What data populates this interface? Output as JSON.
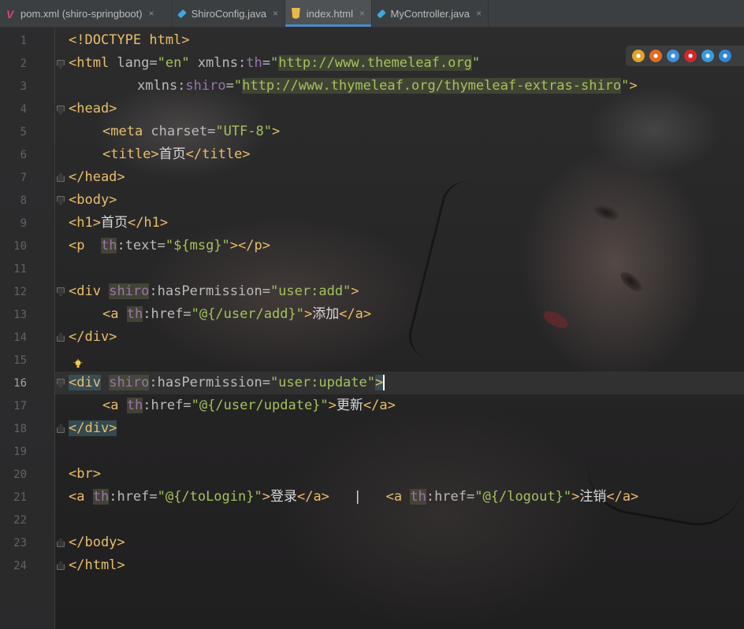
{
  "tabs": [
    {
      "label": "pom.xml (shiro-springboot)",
      "icon": "maven-v-icon",
      "active": false
    },
    {
      "label": "ShiroConfig.java",
      "icon": "java-class-icon",
      "active": false
    },
    {
      "label": "index.html",
      "icon": "html5-icon",
      "active": true
    },
    {
      "label": "MyController.java",
      "icon": "java-class-icon",
      "active": false
    }
  ],
  "close_glyph": "×",
  "line_numbers": [
    "1",
    "2",
    "3",
    "4",
    "5",
    "6",
    "7",
    "8",
    "9",
    "10",
    "11",
    "12",
    "13",
    "14",
    "15",
    "16",
    "17",
    "18",
    "19",
    "20",
    "21",
    "22",
    "23",
    "24"
  ],
  "current_line": "16",
  "code": {
    "l1": [
      "<!DOCTYPE html>"
    ],
    "l2": [
      "<html",
      " lang",
      "=",
      "\"en\"",
      " xmlns:",
      "th",
      "=",
      "\"",
      "http://www.themeleaf.org",
      "\""
    ],
    "l3": [
      "xmlns:",
      "shiro",
      "=",
      "\"",
      "http://www.thymeleaf.org/thymeleaf-extras-shiro",
      "\"",
      ">"
    ],
    "l4": [
      "<head>"
    ],
    "l5": [
      "<meta",
      " charset",
      "=",
      "\"UTF-8\"",
      ">"
    ],
    "l6": [
      "<title>",
      "首页",
      "</title>"
    ],
    "l7": [
      "</head>"
    ],
    "l8": [
      "<body>"
    ],
    "l9": [
      "<h1>",
      "首页",
      "</h1>"
    ],
    "l10": [
      "<p",
      "th",
      ":text",
      "=",
      "\"${msg}\"",
      "></p>"
    ],
    "l12": [
      "<div",
      "shiro",
      ":hasPermission",
      "=",
      "\"user:add\"",
      ">"
    ],
    "l13": [
      "<a",
      "th",
      ":href",
      "=",
      "\"@{/user/add}\"",
      ">",
      "添加",
      "</a>"
    ],
    "l14": [
      "</div>"
    ],
    "l16": [
      "<div",
      "shiro",
      ":hasPermission",
      "=",
      "\"user:update\"",
      ">"
    ],
    "l17": [
      "<a",
      "th",
      ":href",
      "=",
      "\"@{/user/update}\"",
      ">",
      "更新",
      "</a>"
    ],
    "l18": [
      "</div>"
    ],
    "l20": [
      "<br>"
    ],
    "l21": [
      "<a",
      "th",
      ":href",
      "=",
      "\"@{/toLogin}\"",
      ">",
      "登录",
      "</a>",
      "|",
      "<a",
      "th",
      ":href",
      "=",
      "\"@{/logout}\"",
      ">",
      "注销",
      "</a>"
    ],
    "l23": [
      "</body>"
    ],
    "l24": [
      "</html>"
    ]
  },
  "browsers": [
    {
      "name": "chrome-icon",
      "color": "#e0a32a"
    },
    {
      "name": "firefox-icon",
      "color": "#e26b21"
    },
    {
      "name": "safari-icon",
      "color": "#3e8fd8"
    },
    {
      "name": "opera-icon",
      "color": "#d3272e"
    },
    {
      "name": "ie-icon",
      "color": "#3a9ad9"
    },
    {
      "name": "edge-icon",
      "color": "#2f86d4"
    }
  ],
  "colors": {
    "tag": "#e8bf6a",
    "attr": "#bababa",
    "value": "#a5c25c",
    "namespace": "#9876aa",
    "tab_accent": "#4a88c7"
  }
}
